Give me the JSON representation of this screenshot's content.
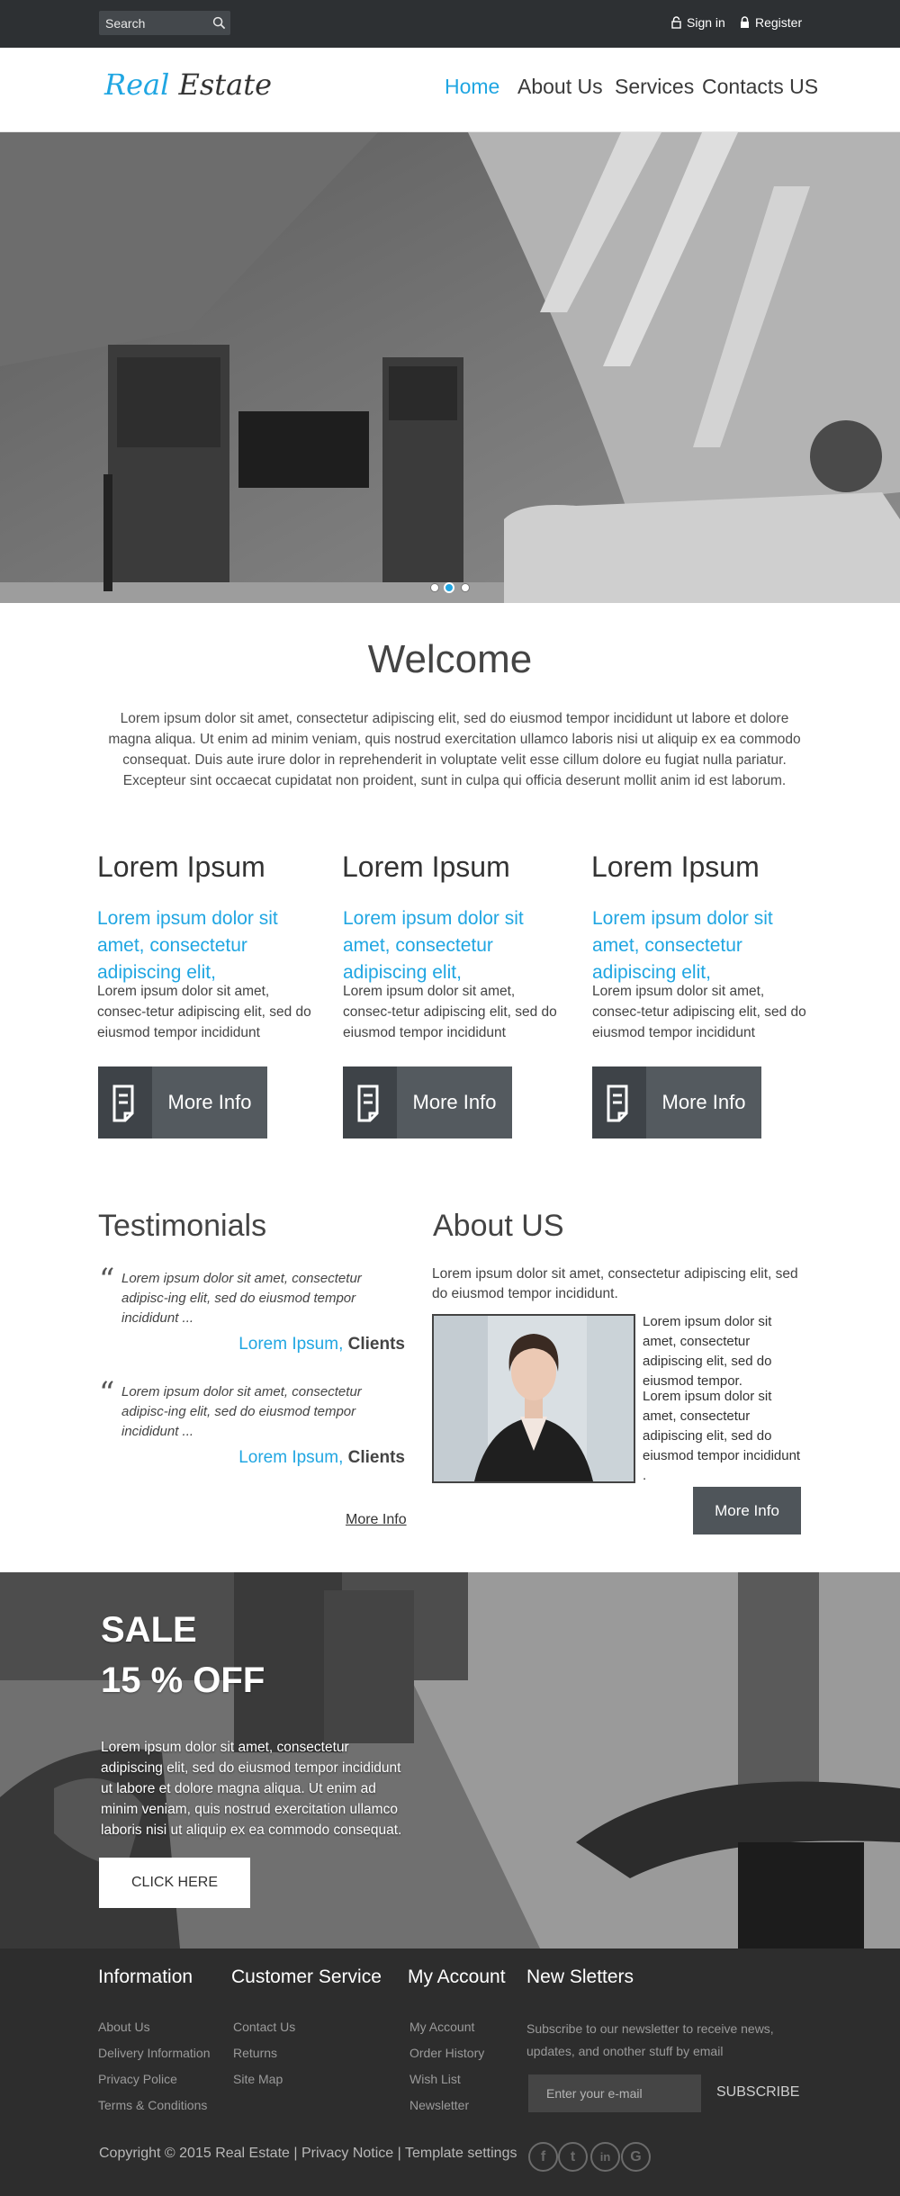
{
  "topbar": {
    "search_placeholder": "Search",
    "signin": "Sign in",
    "register": "Register"
  },
  "logo": {
    "part1": "Real",
    "part2": "Estate"
  },
  "nav": [
    {
      "label": "Home",
      "active": true
    },
    {
      "label": "About Us"
    },
    {
      "label": "Services"
    },
    {
      "label": "Contacts US"
    }
  ],
  "slider": {
    "dots": 3,
    "active": 2
  },
  "welcome": {
    "title": "Welcome",
    "text": "Lorem ipsum dolor sit amet, consectetur adipiscing elit, sed do eiusmod tempor incididunt ut labore et dolore magna aliqua. Ut enim ad minim veniam, quis nostrud exercitation ullamco laboris nisi ut aliquip ex ea commodo consequat. Duis aute irure dolor in reprehenderit in voluptate velit esse cillum dolore eu fugiat nulla pariatur. Excepteur sint occaecat cupidatat non proident, sunt in culpa qui officia deserunt mollit anim id est laborum."
  },
  "columns": [
    {
      "title": "Lorem Ipsum",
      "subtitle": "Lorem ipsum dolor sit amet, consectetur adipiscing elit,",
      "text": "Lorem ipsum dolor sit amet, consec-tetur adipiscing elit, sed do eiusmod tempor incididunt",
      "button": "More Info"
    },
    {
      "title": "Lorem Ipsum",
      "subtitle": "Lorem ipsum dolor sit amet, consectetur adipiscing elit,",
      "text": "Lorem ipsum dolor sit amet, consec-tetur adipiscing elit, sed do eiusmod tempor incididunt",
      "button": "More Info"
    },
    {
      "title": "Lorem Ipsum",
      "subtitle": "Lorem ipsum dolor sit amet, consectetur adipiscing elit,",
      "text": "Lorem ipsum dolor sit amet, consec-tetur adipiscing elit, sed do eiusmod tempor incididunt",
      "button": "More Info"
    }
  ],
  "testimonials": {
    "title": "Testimonials",
    "items": [
      {
        "quote": "Lorem ipsum dolor sit amet, consectetur adipisc-ing elit, sed do eiusmod tempor incididunt ...",
        "name": "Lorem Ipsum,",
        "role": "Clients"
      },
      {
        "quote": "Lorem ipsum dolor sit amet, consectetur adipisc-ing elit, sed do eiusmod tempor incididunt ...",
        "name": "Lorem Ipsum,",
        "role": "Clients"
      }
    ],
    "more": "More Info"
  },
  "about": {
    "title": "About US",
    "intro": "Lorem ipsum dolor sit amet, consectetur adipiscing elit, sed do eiusmod tempor incididunt.",
    "p1": "Lorem ipsum dolor sit amet, consectetur adipiscing elit, sed do eiusmod tempor.",
    "p2": "Lorem ipsum dolor sit amet, consectetur adipiscing elit, sed do eiusmod tempor incididunt .",
    "button": "More Info"
  },
  "sale": {
    "line1": "SALE",
    "line2": "15 % OFF",
    "text": "Lorem ipsum dolor sit amet, consectetur adipiscing elit, sed do eiusmod tempor incididunt ut labore et dolore magna aliqua. Ut enim ad minim veniam, quis nostrud exercitation ullamco laboris nisi ut aliquip ex ea commodo consequat.",
    "button": "CLICK HERE"
  },
  "footer": {
    "information": {
      "title": "Information",
      "links": [
        "About Us",
        "Delivery Information",
        "Privacy Police",
        "Terms & Conditions"
      ]
    },
    "customer": {
      "title": "Customer Service",
      "links": [
        "Contact Us",
        "Returns",
        "Site Map"
      ]
    },
    "account": {
      "title": "My Account",
      "links": [
        "My Account",
        "Order History",
        "Wish List",
        "Newsletter"
      ]
    },
    "newsletter": {
      "title": "New Sletters",
      "text": "Subscribe to our newsletter to receive news, updates, and onother stuff by email",
      "placeholder": "Enter your e-mail",
      "button": "SUBSCRIBE"
    },
    "copyright": "Copyright © 2015 Real Estate",
    "privacy": "Privacy Notice",
    "template": "Template settings",
    "social": [
      "f",
      "t",
      "in",
      "G"
    ]
  },
  "colors": {
    "accent": "#20a6e2",
    "dark": "#2d3033",
    "button": "#545a5f"
  },
  "icons": [
    "search-icon",
    "lock-icon",
    "document-icon",
    "facebook-icon",
    "twitter-icon",
    "linkedin-icon",
    "google-icon"
  ]
}
